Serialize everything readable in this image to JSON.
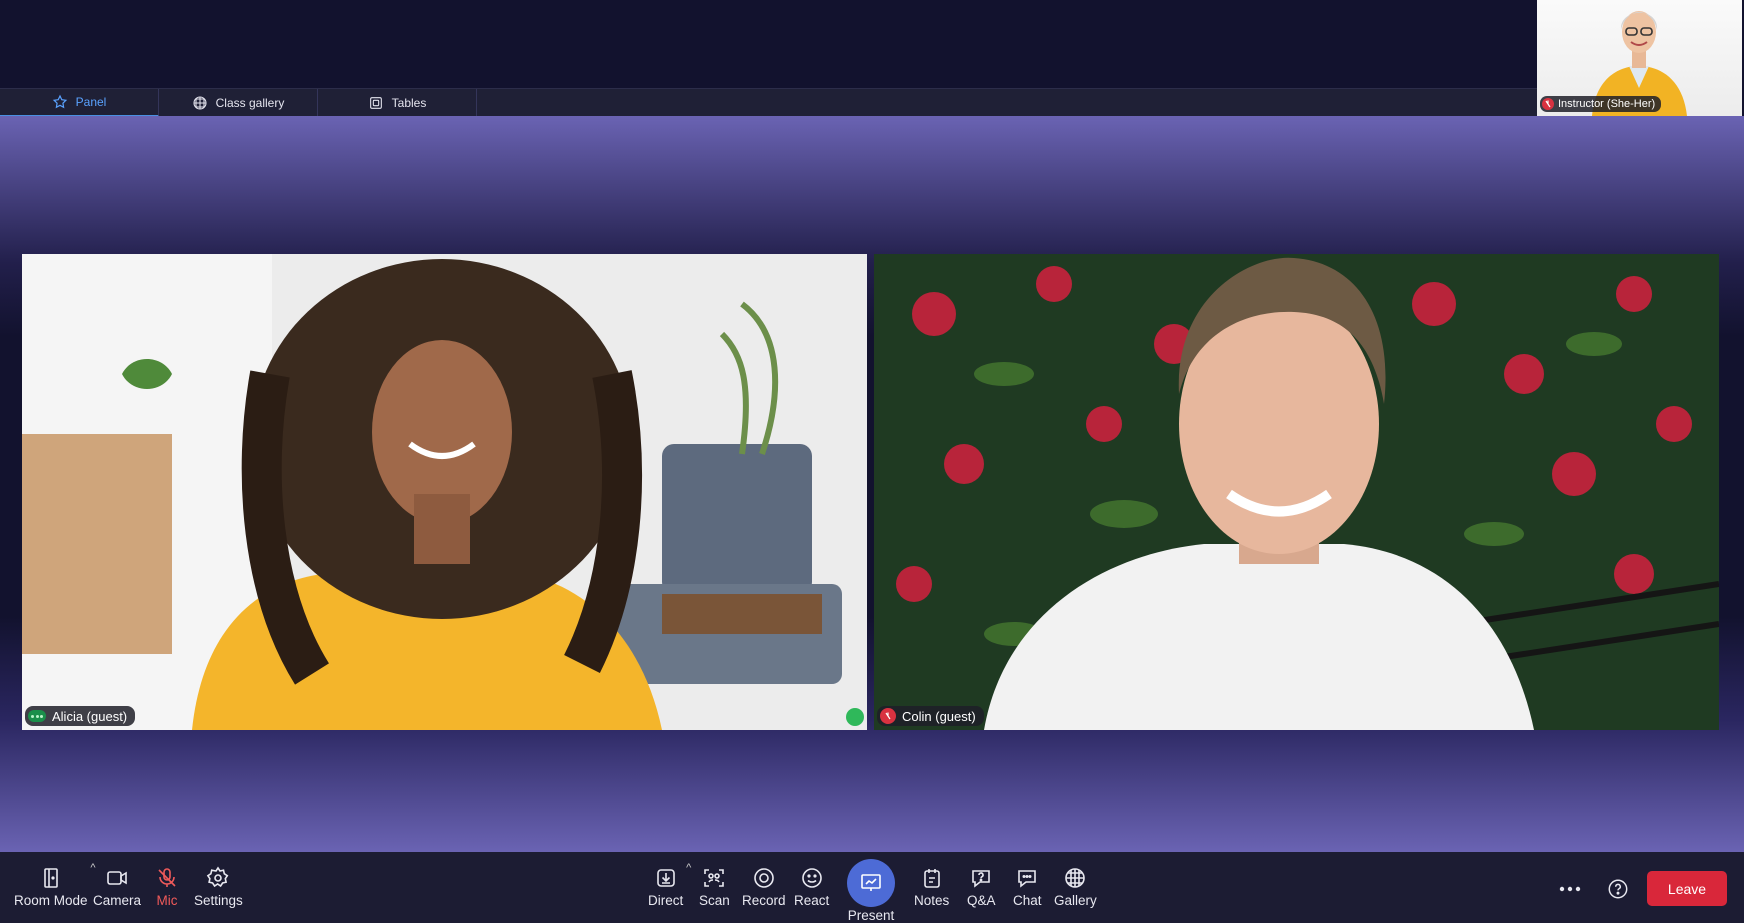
{
  "tabs": [
    {
      "label": "Panel",
      "icon": "star-icon",
      "active": true
    },
    {
      "label": "Class gallery",
      "icon": "grid-icon",
      "active": false
    },
    {
      "label": "Tables",
      "icon": "tables-icon",
      "active": false
    }
  ],
  "instructor": {
    "name": "Instructor (She-Her)",
    "muted": true
  },
  "participants": [
    {
      "name": "Alicia (guest)",
      "status": "speaking"
    },
    {
      "name": "Colin (guest)",
      "status": "muted"
    }
  ],
  "toolbar": {
    "room_mode": "Room Mode",
    "camera": "Camera",
    "mic": "Mic",
    "settings": "Settings",
    "direct": "Direct",
    "scan": "Scan",
    "record": "Record",
    "react": "React",
    "present": "Present",
    "notes": "Notes",
    "qa": "Q&A",
    "chat": "Chat",
    "gallery": "Gallery",
    "leave": "Leave"
  },
  "colors": {
    "accent": "#4d6bd6",
    "leave": "#d9273a",
    "mic_off": "#f05a5a",
    "active_tab": "#5aa2ff",
    "speaking": "#2fb85a"
  }
}
